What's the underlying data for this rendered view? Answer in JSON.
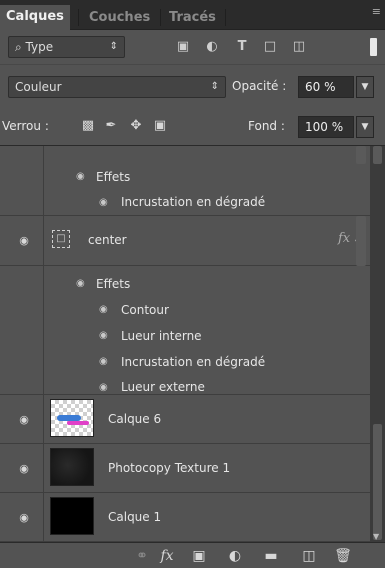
{
  "tabs": [
    "Calques",
    "Couches",
    "Tracés"
  ],
  "filter": {
    "kind_label": "⌕ Type"
  },
  "blend": {
    "mode": "Couleur",
    "opacity_label": "Opacité :",
    "opacity_value": "60 %"
  },
  "lock": {
    "label": "Verrou :",
    "fill_label": "Fond :",
    "fill_value": "100 %"
  },
  "layers": {
    "partial": {
      "effects_label": "Effets",
      "effect_items": [
        "Incrustation en dégradé"
      ]
    },
    "center": {
      "name": "center",
      "fx": "fx",
      "effects_label": "Effets",
      "effect_items": [
        "Contour",
        "Lueur interne",
        "Incrustation en dégradé",
        "Lueur externe"
      ]
    },
    "calque6": {
      "name": "Calque 6"
    },
    "photocopy": {
      "name": "Photocopy Texture 1"
    },
    "calque1": {
      "name": "Calque 1"
    }
  },
  "footer": {
    "fx_label": "fx"
  },
  "colors": {
    "panel": "#535353",
    "dark": "#2b2b2b",
    "field": "#2f2f2f"
  }
}
